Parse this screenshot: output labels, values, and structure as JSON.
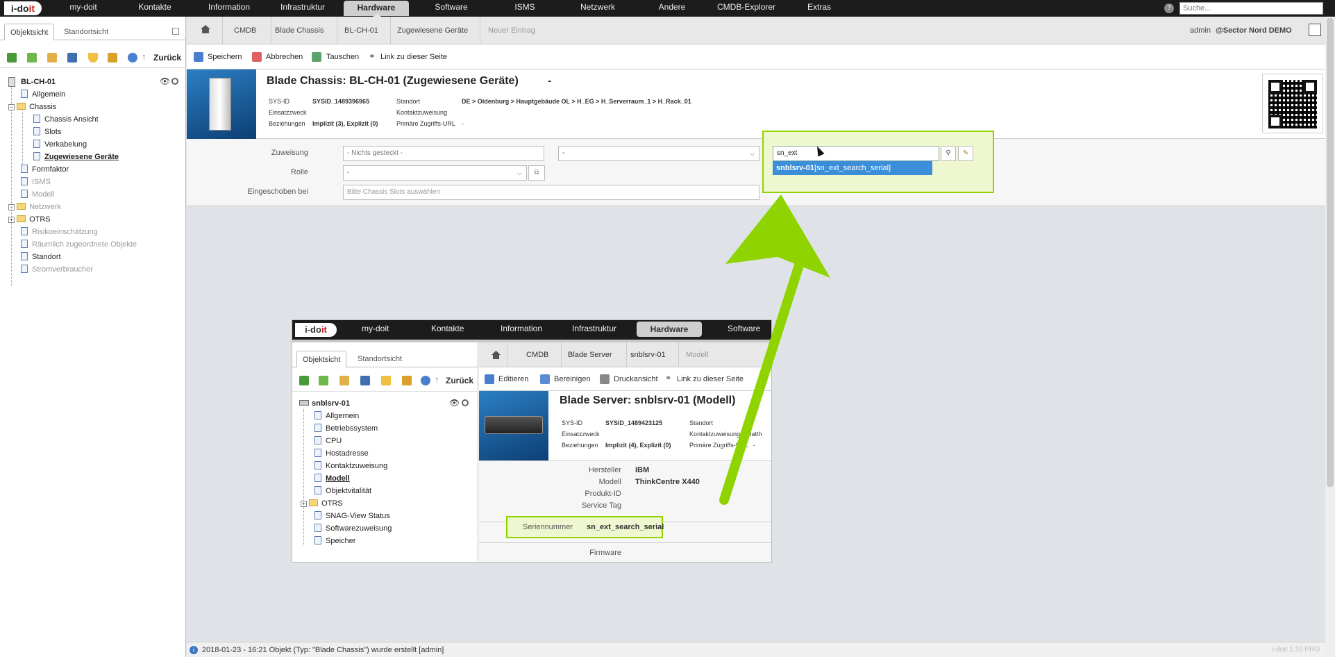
{
  "app": {
    "logo_left": "i-do",
    "logo_right": "it",
    "version": "i-doit 1.10 PRO"
  },
  "topnav": {
    "items": [
      "my-doit",
      "Kontakte",
      "Information",
      "Infrastruktur",
      "Hardware",
      "Software",
      "ISMS",
      "Netzwerk",
      "Andere",
      "CMDB-Explorer",
      "Extras"
    ],
    "active": "Hardware",
    "search_placeholder": "Suche..."
  },
  "user": {
    "name": "admin",
    "tenant": "@Sector Nord DEMO"
  },
  "leftpanel": {
    "tabs": [
      "Objektsicht",
      "Standortsicht"
    ],
    "back_label": "Zurück",
    "root": "BL-CH-01",
    "tree": [
      {
        "label": "Allgemein",
        "level": 1,
        "type": "page",
        "state": "normal"
      },
      {
        "label": "Chassis",
        "level": 1,
        "type": "folder",
        "state": "normal",
        "expander": "-"
      },
      {
        "label": "Chassis Ansicht",
        "level": 2,
        "type": "page",
        "state": "normal"
      },
      {
        "label": "Slots",
        "level": 2,
        "type": "page",
        "state": "normal"
      },
      {
        "label": "Verkabelung",
        "level": 2,
        "type": "page",
        "state": "normal"
      },
      {
        "label": "Zugewiesene Geräte",
        "level": 2,
        "type": "page",
        "state": "active"
      },
      {
        "label": "Formfaktor",
        "level": 1,
        "type": "page",
        "state": "normal"
      },
      {
        "label": "ISMS",
        "level": 1,
        "type": "page",
        "state": "dim"
      },
      {
        "label": "Modell",
        "level": 1,
        "type": "page",
        "state": "dim"
      },
      {
        "label": "Netzwerk",
        "level": 1,
        "type": "folder",
        "state": "dim",
        "expander": "+"
      },
      {
        "label": "OTRS",
        "level": 1,
        "type": "folder",
        "state": "normal",
        "expander": "+"
      },
      {
        "label": "Risikoeinschätzung",
        "level": 1,
        "type": "page",
        "state": "dim"
      },
      {
        "label": "Räumlich zugeordnete Objekte",
        "level": 1,
        "type": "page",
        "state": "dim"
      },
      {
        "label": "Standort",
        "level": 1,
        "type": "page",
        "state": "normal"
      },
      {
        "label": "Stromverbraucher",
        "level": 1,
        "type": "page",
        "state": "dim"
      }
    ]
  },
  "breadcrumb": [
    "CMDB",
    "Blade Chassis",
    "BL-CH-01",
    "Zugewiesene Geräte",
    "Neuer Eintrag"
  ],
  "toolbar": {
    "save": "Speichern",
    "cancel": "Abbrechen",
    "swap": "Tauschen",
    "link": "Link zu dieser Seite"
  },
  "header": {
    "title": "Blade Chassis: BL-CH-01 (Zugewiesene Geräte)",
    "title_suffix": "-",
    "fields": {
      "sysid_label": "SYS-ID",
      "sysid_value": "SYSID_1489396965",
      "purpose_label": "Einsatzzweck",
      "purpose_value": "",
      "relations_label": "Beziehungen",
      "relations_value": "Implizit (3), Explizit (0)",
      "location_label": "Standort",
      "location_value": "DE > Oldenburg > Hauptgebäude OL > H_EG > H_Serverraum_1 > H_Rack_01",
      "contact_label": "Kontaktzuweisung",
      "contact_value": "",
      "url_label": "Primäre Zugriffs-URL",
      "url_value": "-"
    }
  },
  "form": {
    "assignment_label": "Zuweisung",
    "assignment_value": "- Nichts gesteckt -",
    "select_value": "-",
    "role_label": "Rolle",
    "role_value": "-",
    "inserted_label": "Eingeschoben bei",
    "inserted_placeholder": "Bitte Chassis Slots auswählen",
    "search_value": "sn_ext",
    "suggestion_title": "snblsrv-01",
    "suggestion_detail": "[sn_ext_search_serial]"
  },
  "inset": {
    "topnav": [
      "my-doit",
      "Kontakte",
      "Information",
      "Infrastruktur",
      "Hardware",
      "Software"
    ],
    "active": "Hardware",
    "tabs": [
      "Objektsicht",
      "Standortsicht"
    ],
    "back_label": "Zurück",
    "breadcrumb": [
      "CMDB",
      "Blade Server",
      "snblsrv-01",
      "Modell"
    ],
    "toolbar": {
      "edit": "Editieren",
      "purge": "Bereinigen",
      "print": "Druckansicht",
      "link": "Link zu dieser Seite"
    },
    "root": "snblsrv-01",
    "tree": [
      "Allgemein",
      "Betriebssystem",
      "CPU",
      "Hostadresse",
      "Kontaktzuweisung",
      "Modell",
      "Objektvitalität",
      "OTRS",
      "SNAG-View Status",
      "Softwarezuweisung",
      "Speicher"
    ],
    "tree_active": "Modell",
    "title": "Blade Server: snblsrv-01 (Modell)",
    "fields": {
      "sysid_label": "SYS-ID",
      "sysid_value": "SYSID_1489423125",
      "purpose_label": "Einsatzzweck",
      "relations_label": "Beziehungen",
      "relations_value": "Implizit (4), Explizit (0)",
      "location_label": "Standort",
      "contact_label": "Kontaktzuweisung",
      "contact_value": "Matth",
      "url_label": "Primäre Zugriffs-URL",
      "url_value": "-"
    },
    "model": [
      {
        "label": "Hersteller",
        "value": "IBM"
      },
      {
        "label": "Modell",
        "value": "ThinkCentre X440"
      },
      {
        "label": "Produkt-ID",
        "value": ""
      },
      {
        "label": "Service Tag",
        "value": ""
      }
    ],
    "serial_label": "Seriennummer",
    "serial_value": "sn_ext_search_serial",
    "firmware_label": "Firmware"
  },
  "status": {
    "message": "2018-01-23 - 16:21 Objekt (Typ: \"Blade Chassis\") wurde erstellt [admin]"
  },
  "colors": {
    "accent_green": "#8fd400",
    "highlight_green_fill": "#eef7cf",
    "nav_bg": "#1c1c1c",
    "suggest_blue": "#3b8fd9"
  }
}
